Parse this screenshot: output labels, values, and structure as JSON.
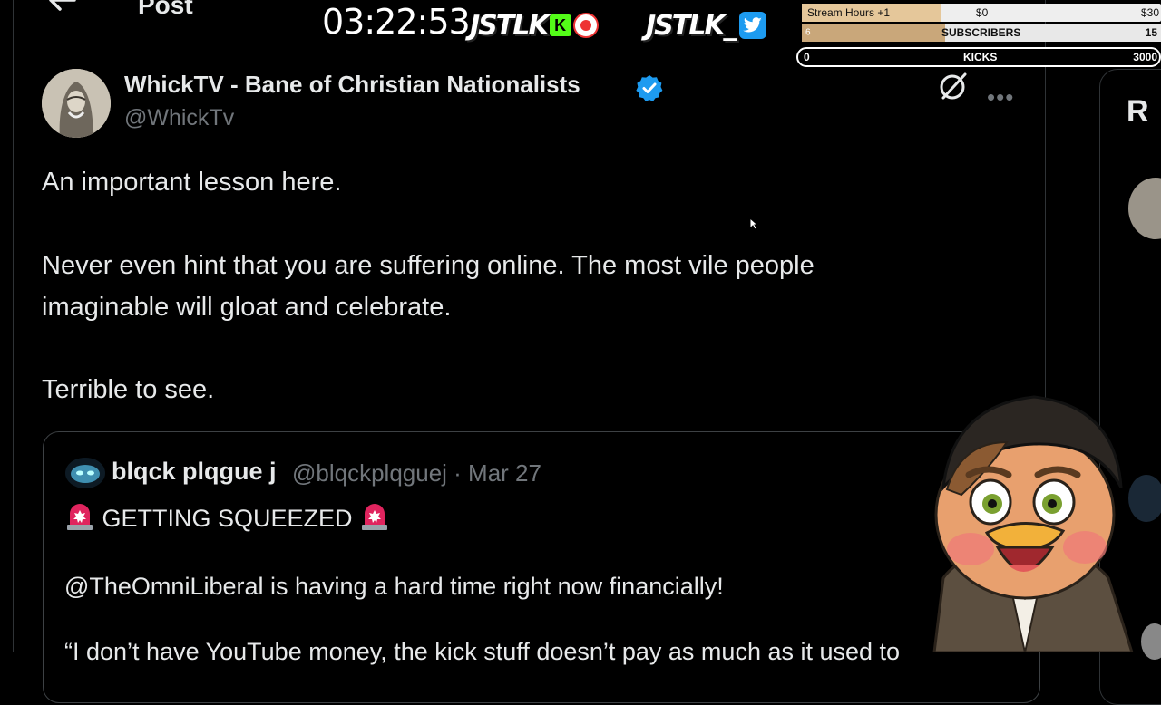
{
  "header": {
    "title": "Post"
  },
  "stream_overlay": {
    "timer": "03:22:53",
    "badge_kick_text": "JSTLK",
    "badge_kick_letter": "K",
    "badge_twitter_text": "JSTLK_",
    "goals": {
      "hours": {
        "label": "Stream Hours +1",
        "current": "$0",
        "target": "$30",
        "progress": 0.39
      },
      "subscribers": {
        "label": "SUBSCRIBERS",
        "current": "6",
        "target": "15",
        "progress": 0.4
      },
      "kicks": {
        "label": "KICKS",
        "current": "0",
        "target": "3000",
        "progress": 0
      }
    }
  },
  "tweet": {
    "author_name": "WhickTV - Bane of Christian Nationalists",
    "author_handle": "@WhickTv",
    "verified": true,
    "lines": [
      "An important lesson here.",
      "Never even hint that you are suffering online. The most vile people",
      "imaginable will gloat and celebrate.",
      "Terrible to see."
    ]
  },
  "quote": {
    "author_name": "blqck plqgue j",
    "meta": "@blqckplqguej · Mar 27",
    "headline": "GETTING SQUEEZED",
    "line2": "@TheOmniLiberal is having a hard time right now financially!",
    "line3": "“I don’t have YouTube money, the kick stuff doesn’t pay as much as it used to"
  },
  "right_panel": {
    "partial_heading": "R"
  },
  "colors": {
    "background": "#000000",
    "text": "#e7e9ea",
    "muted": "#71767b",
    "verified": "#1d9bf0",
    "kick_green": "#53fc18"
  },
  "icons": [
    "back-arrow-icon",
    "verified-icon",
    "grok-icon",
    "more-icon",
    "siren-icon",
    "twitter-bird-icon",
    "record-icon"
  ]
}
